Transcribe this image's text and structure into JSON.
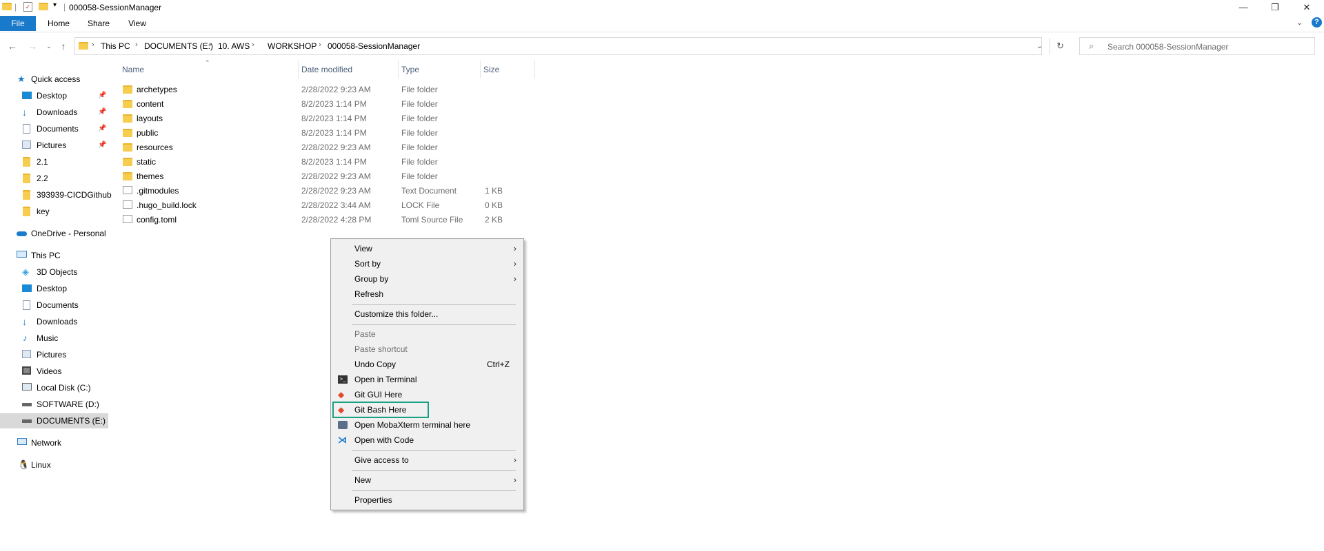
{
  "window": {
    "title": "000058-SessionManager",
    "controls": {
      "minimize": "—",
      "restore": "❐",
      "close": "✕"
    },
    "help": "?"
  },
  "ribbon": {
    "tabs": [
      "File",
      "Home",
      "Share",
      "View"
    ]
  },
  "address": {
    "crumbs": [
      "This PC",
      "DOCUMENTS (E:)",
      "10. AWS",
      "WORKSHOP",
      "000058-SessionManager"
    ]
  },
  "search": {
    "placeholder": "Search 000058-SessionManager"
  },
  "navpane": {
    "quick_access": "Quick access",
    "qa_items": [
      "Desktop",
      "Downloads",
      "Documents",
      "Pictures",
      "2.1",
      "2.2",
      "393939-CICDGithub",
      "key"
    ],
    "onedrive": "OneDrive - Personal",
    "this_pc": "This PC",
    "pc_items": [
      "3D Objects",
      "Desktop",
      "Documents",
      "Downloads",
      "Music",
      "Pictures",
      "Videos",
      "Local Disk (C:)",
      "SOFTWARE (D:)",
      "DOCUMENTS (E:)"
    ],
    "network": "Network",
    "linux": "Linux"
  },
  "columns": {
    "name": "Name",
    "date": "Date modified",
    "type": "Type",
    "size": "Size"
  },
  "files": [
    {
      "name": "archetypes",
      "date": "2/28/2022 9:23 AM",
      "type": "File folder",
      "size": "",
      "icon": "folder-icon"
    },
    {
      "name": "content",
      "date": "8/2/2023 1:14 PM",
      "type": "File folder",
      "size": "",
      "icon": "folder-icon"
    },
    {
      "name": "layouts",
      "date": "8/2/2023 1:14 PM",
      "type": "File folder",
      "size": "",
      "icon": "folder-icon"
    },
    {
      "name": "public",
      "date": "8/2/2023 1:14 PM",
      "type": "File folder",
      "size": "",
      "icon": "folder-icon"
    },
    {
      "name": "resources",
      "date": "2/28/2022 9:23 AM",
      "type": "File folder",
      "size": "",
      "icon": "folder-icon"
    },
    {
      "name": "static",
      "date": "8/2/2023 1:14 PM",
      "type": "File folder",
      "size": "",
      "icon": "folder-icon"
    },
    {
      "name": "themes",
      "date": "2/28/2022 9:23 AM",
      "type": "File folder",
      "size": "",
      "icon": "folder-icon"
    },
    {
      "name": ".gitmodules",
      "date": "2/28/2022 9:23 AM",
      "type": "Text Document",
      "size": "1 KB",
      "icon": "text-file-icon"
    },
    {
      "name": ".hugo_build.lock",
      "date": "2/28/2022 3:44 AM",
      "type": "LOCK File",
      "size": "0 KB",
      "icon": "file-icon"
    },
    {
      "name": "config.toml",
      "date": "2/28/2022 4:28 PM",
      "type": "Toml Source File",
      "size": "2 KB",
      "icon": "text-file-icon"
    }
  ],
  "context_menu": {
    "view": "View",
    "sort_by": "Sort by",
    "group_by": "Group by",
    "refresh": "Refresh",
    "customize": "Customize this folder...",
    "paste": "Paste",
    "paste_shortcut": "Paste shortcut",
    "undo_copy": "Undo Copy",
    "undo_shortcut": "Ctrl+Z",
    "open_terminal": "Open in Terminal",
    "git_gui": "Git GUI Here",
    "git_bash": "Git Bash Here",
    "mobaxterm": "Open MobaXterm terminal here",
    "open_code": "Open with Code",
    "give_access": "Give access to",
    "new": "New",
    "properties": "Properties"
  },
  "colors": {
    "accent": "#1979ca",
    "highlight": "#1aa083",
    "folder": "#f6cd4e",
    "selected_nav": "#cce8ff"
  }
}
